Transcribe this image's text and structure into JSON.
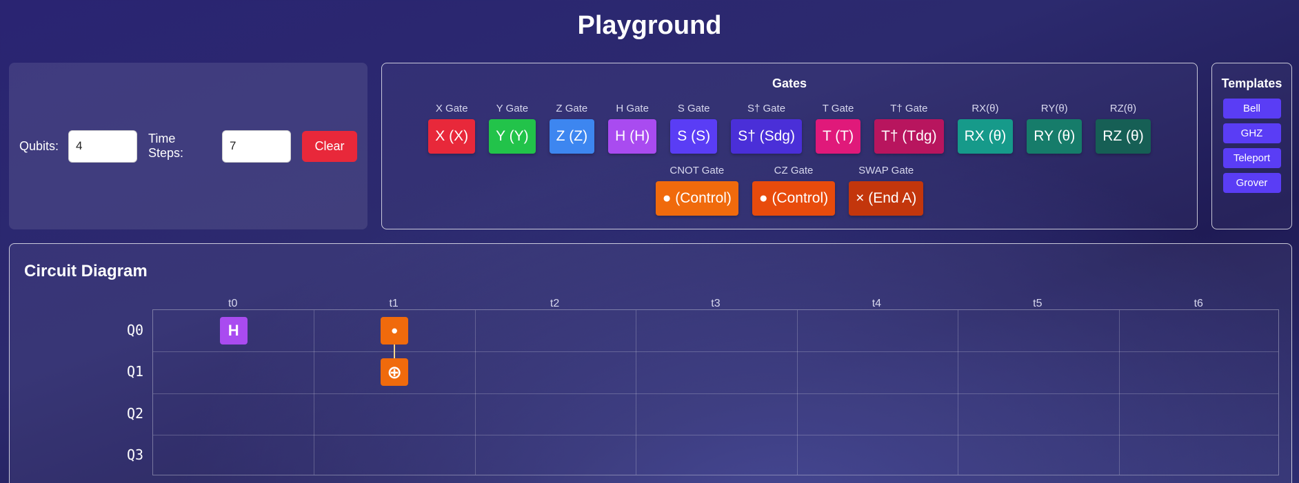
{
  "header": {
    "title": "Playground"
  },
  "controls": {
    "qubits_label": "Qubits:",
    "qubits_value": "4",
    "timesteps_label": "Time Steps:",
    "timesteps_value": "7",
    "clear_label": "Clear"
  },
  "gates": {
    "title": "Gates",
    "row1": [
      {
        "name": "X Gate",
        "label": "X (X)",
        "color": "#e8283a"
      },
      {
        "name": "Y Gate",
        "label": "Y (Y)",
        "color": "#22c34a"
      },
      {
        "name": "Z Gate",
        "label": "Z (Z)",
        "color": "#3d86f0"
      },
      {
        "name": "H Gate",
        "label": "H (H)",
        "color": "#a94bf0"
      },
      {
        "name": "S Gate",
        "label": "S (S)",
        "color": "#5a3df5"
      },
      {
        "name": "S† Gate",
        "label": "S† (Sdg)",
        "color": "#4a2fd8"
      },
      {
        "name": "T Gate",
        "label": "T (T)",
        "color": "#e0197a"
      },
      {
        "name": "T† Gate",
        "label": "T† (Tdg)",
        "color": "#b8155e"
      },
      {
        "name": "RX(θ)",
        "label": "RX (θ)",
        "color": "#169a8a"
      },
      {
        "name": "RY(θ)",
        "label": "RY (θ)",
        "color": "#167c6a"
      },
      {
        "name": "RZ(θ)",
        "label": "RZ (θ)",
        "color": "#165f55"
      }
    ],
    "row2": [
      {
        "name": "CNOT Gate",
        "label": "● (Control)",
        "color": "#f06a0c"
      },
      {
        "name": "CZ Gate",
        "label": "● (Control)",
        "color": "#e84b0c"
      },
      {
        "name": "SWAP Gate",
        "label": "× (End A)",
        "color": "#c3360c"
      }
    ]
  },
  "templates": {
    "title": "Templates",
    "items": [
      "Bell",
      "GHZ",
      "Teleport",
      "Grover"
    ]
  },
  "circuit": {
    "title": "Circuit Diagram",
    "time_labels": [
      "t0",
      "t1",
      "t2",
      "t3",
      "t4",
      "t5",
      "t6"
    ],
    "qubit_labels": [
      "Q0",
      "Q1",
      "Q2",
      "Q3"
    ],
    "placed_gates": [
      {
        "qubit": 0,
        "step": 0,
        "symbol": "H",
        "color": "#a94bf0",
        "kind": "single"
      },
      {
        "qubit": 0,
        "step": 1,
        "symbol": "•",
        "color": "#f06a0c",
        "kind": "control"
      },
      {
        "qubit": 1,
        "step": 1,
        "symbol": "⊕",
        "color": "#f06a0c",
        "kind": "target"
      }
    ]
  }
}
